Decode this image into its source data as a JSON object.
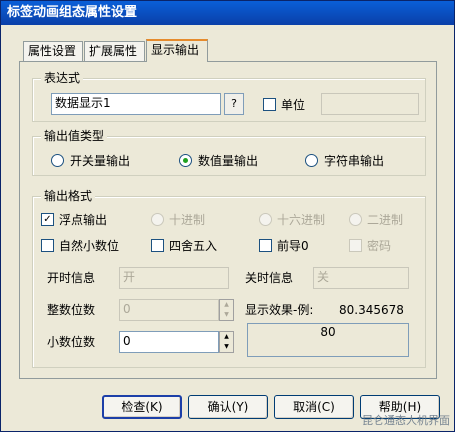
{
  "window": {
    "title": "标签动画组态属性设置"
  },
  "tabs": [
    {
      "label": "属性设置"
    },
    {
      "label": "扩展属性"
    },
    {
      "label": "显示输出"
    }
  ],
  "expression": {
    "legend": "表达式",
    "value": "数据显示1",
    "browse_label": "?",
    "unit_label": "单位",
    "unit_value": ""
  },
  "output_type": {
    "legend": "输出值类型",
    "options": [
      {
        "label": "开关量输出",
        "checked": false
      },
      {
        "label": "数值量输出",
        "checked": true
      },
      {
        "label": "字符串输出",
        "checked": false
      }
    ]
  },
  "format": {
    "legend": "输出格式",
    "float_label": "浮点输出",
    "decimal_label": "十进制",
    "hex_label": "十六进制",
    "binary_label": "二进制",
    "natural_label": "自然小数位",
    "round_label": "四舍五入",
    "leading_zero_label": "前导0",
    "password_label": "密码",
    "on_label": "开时信息",
    "on_value": "开",
    "off_label": "关时信息",
    "off_value": "关",
    "int_digits_label": "整数位数",
    "int_digits_value": "0",
    "dec_digits_label": "小数位数",
    "dec_digits_value": "0",
    "preview_label": "显示效果-例:",
    "preview_example": "80.345678",
    "preview_result": "80"
  },
  "buttons": {
    "check": "检查(K)",
    "ok": "确认(Y)",
    "cancel": "取消(C)",
    "help": "帮助(H)"
  },
  "watermark": "昆仑通态人机界面"
}
